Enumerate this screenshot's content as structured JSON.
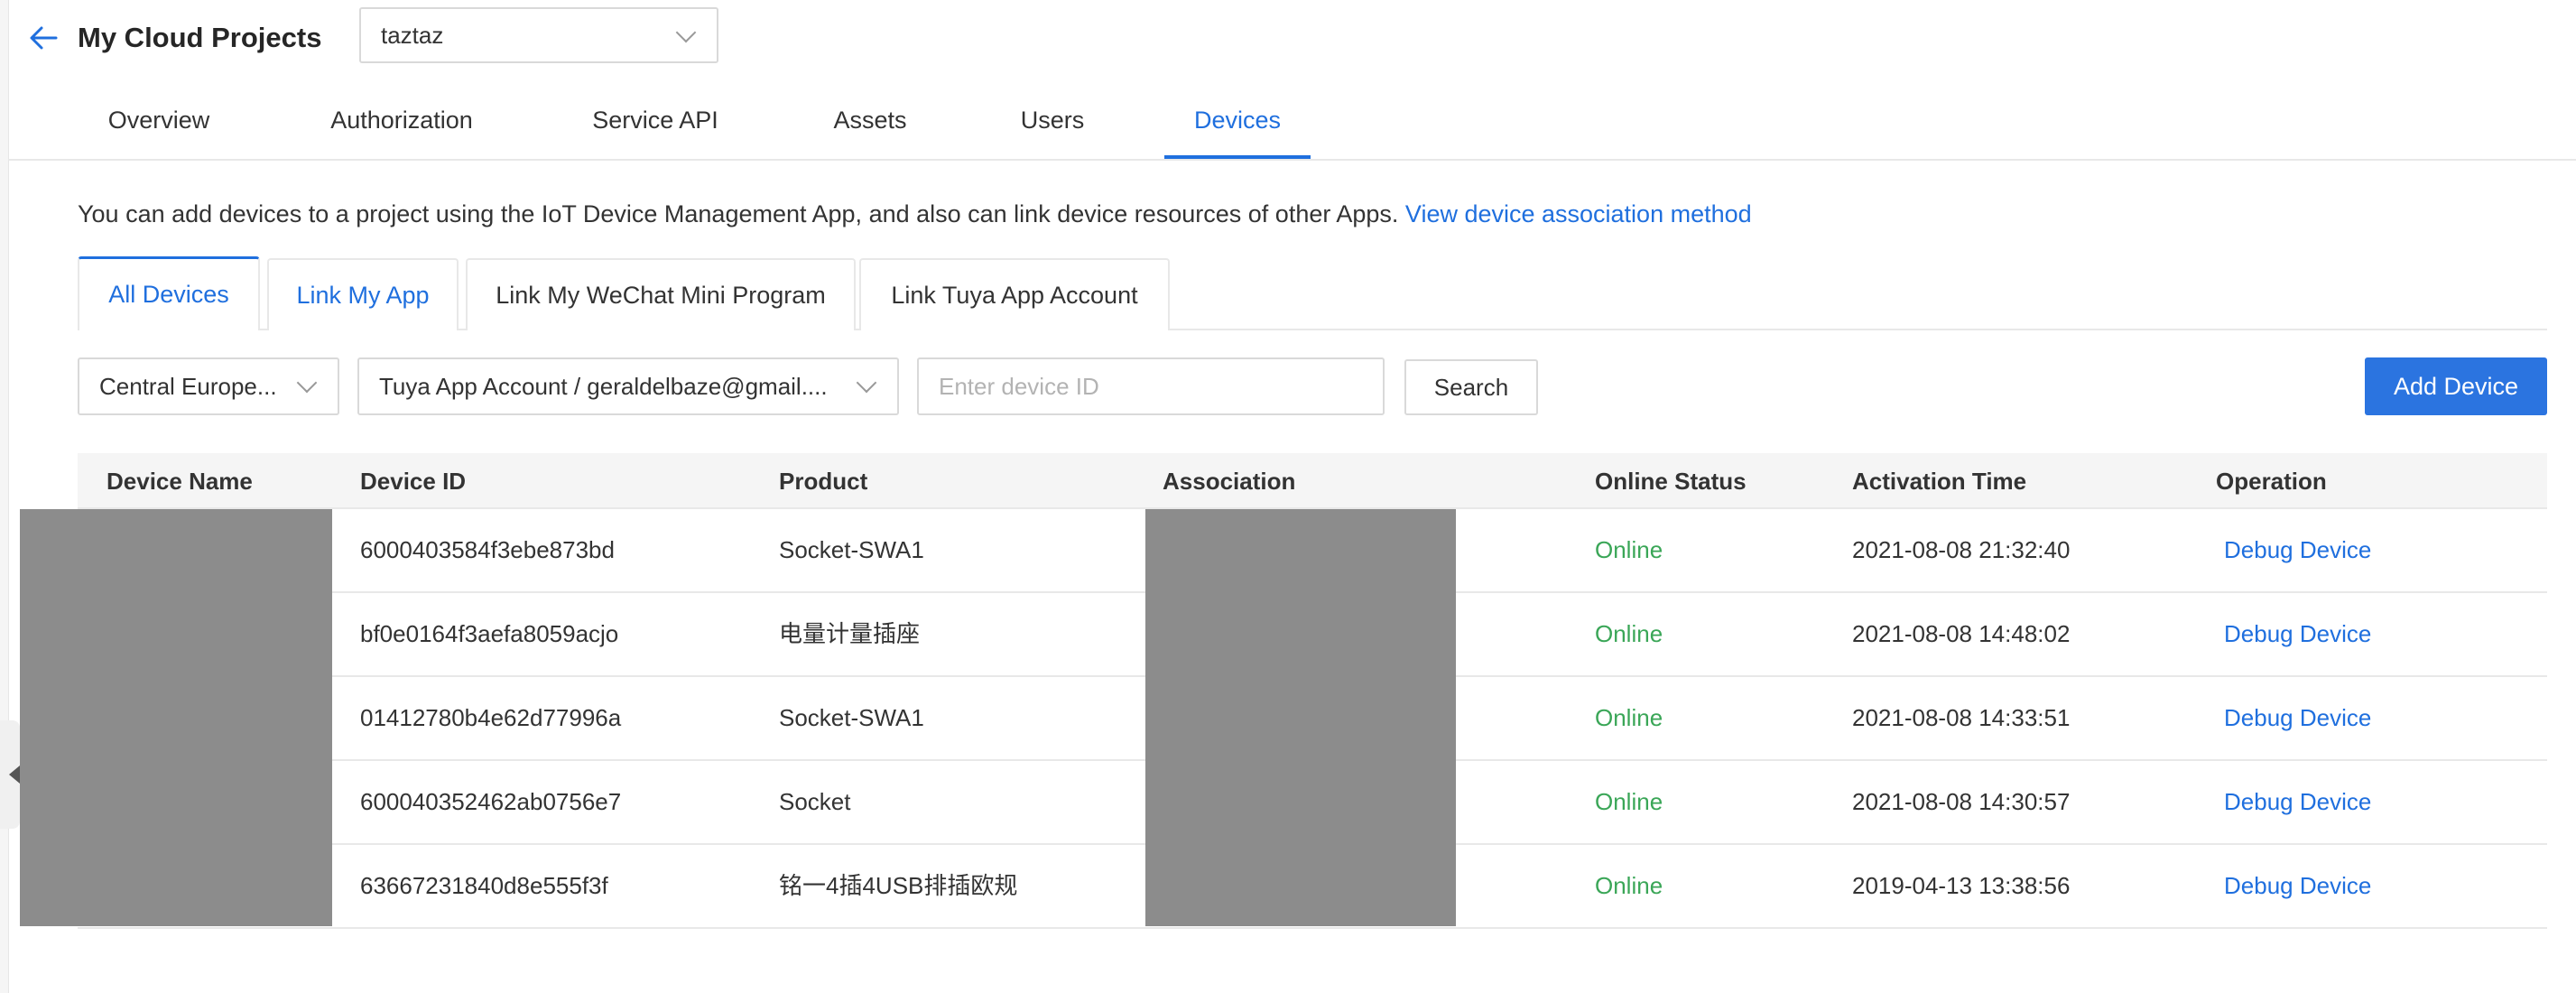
{
  "header": {
    "title": "My Cloud Projects",
    "project_selected": "taztaz"
  },
  "main_tabs": [
    {
      "label": "Overview"
    },
    {
      "label": "Authorization"
    },
    {
      "label": "Service API"
    },
    {
      "label": "Assets"
    },
    {
      "label": "Users"
    },
    {
      "label": "Devices"
    }
  ],
  "info": {
    "text": "You can add devices to a project using the IoT Device Management App, and also can link device resources of other Apps.",
    "link": "View device association method"
  },
  "sub_tabs": [
    {
      "label": "All Devices"
    },
    {
      "label": "Link My App"
    },
    {
      "label": "Link My WeChat Mini Program"
    },
    {
      "label": "Link Tuya App Account"
    }
  ],
  "filters": {
    "region": "Central Europe...",
    "account": "Tuya App Account / geraldelbaze@gmail....",
    "device_id_placeholder": "Enter device ID",
    "search_label": "Search",
    "add_label": "Add Device"
  },
  "table": {
    "columns": [
      "Device Name",
      "Device ID",
      "Product",
      "Association",
      "Online Status",
      "Activation Time",
      "Operation"
    ],
    "rows": [
      {
        "device_id": "6000403584f3ebe873bd",
        "product": "Socket-SWA1",
        "status": "Online",
        "activation_time": "2021-08-08 21:32:40",
        "operation": "Debug Device"
      },
      {
        "device_id": "bf0e0164f3aefa8059acjo",
        "product": "电量计量插座",
        "status": "Online",
        "activation_time": "2021-08-08 14:48:02",
        "operation": "Debug Device"
      },
      {
        "device_id": "01412780b4e62d77996a",
        "product": "Socket-SWA1",
        "status": "Online",
        "activation_time": "2021-08-08 14:33:51",
        "operation": "Debug Device"
      },
      {
        "device_id": "600040352462ab0756e7",
        "product": "Socket",
        "status": "Online",
        "activation_time": "2021-08-08 14:30:57",
        "operation": "Debug Device"
      },
      {
        "device_id": "63667231840d8e555f3f",
        "product": "铭一4插4USB排插欧规",
        "status": "Online",
        "activation_time": "2019-04-13 13:38:56",
        "operation": "Debug Device"
      }
    ]
  },
  "colors": {
    "accent": "#1f6fde",
    "primary_button": "#2b74e0",
    "online": "#3aa657",
    "redaction": "#8c8c8c"
  }
}
